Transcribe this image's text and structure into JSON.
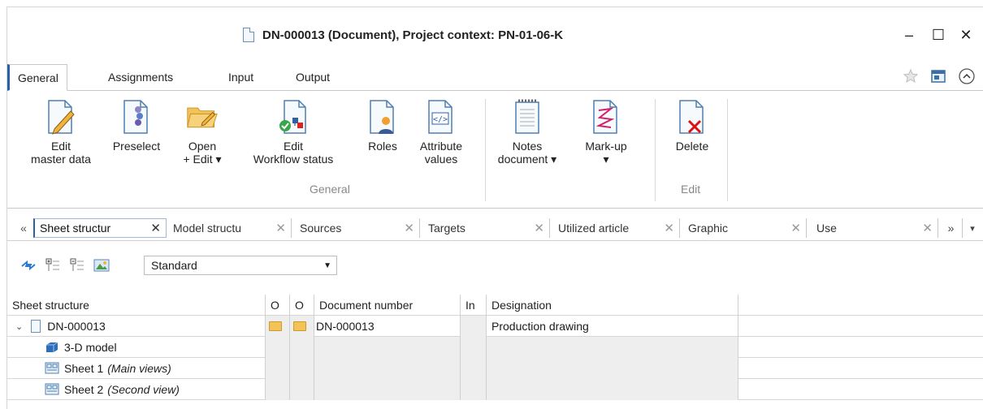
{
  "window": {
    "title": "DN-000013 (Document), Project context: PN-01-06-K",
    "minimize": "–",
    "maximize": "☐",
    "close": "✕"
  },
  "ribbon_tabs": [
    "General",
    "Assignments",
    "Input",
    "Output"
  ],
  "ribbon": {
    "buttons": [
      {
        "line1": "Edit",
        "line2": "master data"
      },
      {
        "line1": "Preselect",
        "line2": ""
      },
      {
        "line1": "Open",
        "line2": "+ Edit ▾"
      },
      {
        "line1": "Edit",
        "line2": "Workflow status"
      },
      {
        "line1": "Roles",
        "line2": ""
      },
      {
        "line1": "Attribute",
        "line2": "values"
      },
      {
        "line1": "Notes",
        "line2": "document ▾"
      },
      {
        "line1": "Mark-up",
        "line2": "▾"
      },
      {
        "line1": "Delete",
        "line2": ""
      }
    ],
    "group_general": "General",
    "group_edit": "Edit"
  },
  "doc_tabs": {
    "left_scroll": "«",
    "right_scroll": "»",
    "menu": "▾",
    "tabs": [
      "Sheet structur",
      "Model structu",
      "Sources",
      "Targets",
      "Utilized article",
      "Graphic",
      "Use"
    ],
    "close": "✕"
  },
  "toolbar": {
    "view_value": "Standard"
  },
  "grid": {
    "columns": [
      "Sheet structure",
      "O",
      "O",
      "Document number",
      "In",
      "Designation"
    ],
    "rows": [
      {
        "name": "DN-000013",
        "doc_number": "DN-000013",
        "designation": "Production drawing"
      },
      {
        "name": "3-D model"
      },
      {
        "name": "Sheet 1",
        "note": "(Main views)"
      },
      {
        "name": "Sheet 2",
        "note": "(Second view)"
      }
    ]
  }
}
